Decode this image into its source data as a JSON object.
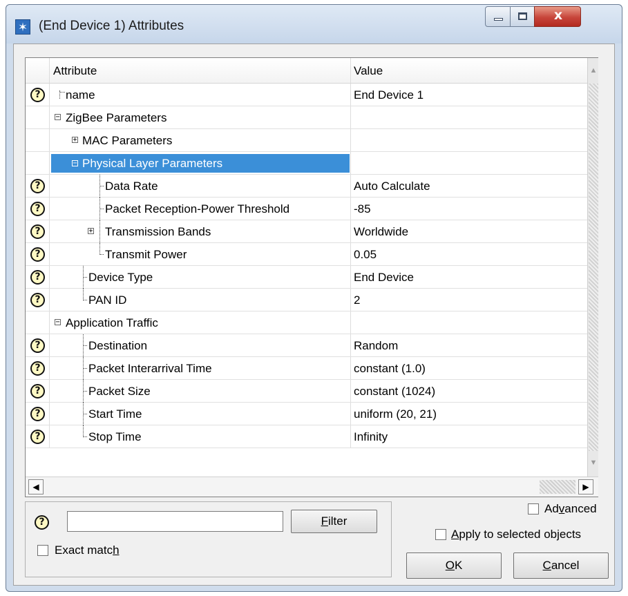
{
  "window": {
    "title": "(End Device 1) Attributes",
    "app_icon": "✶",
    "close_glyph": "x"
  },
  "table": {
    "header": {
      "attribute": "Attribute",
      "value": "Value"
    },
    "rows": [
      {
        "label": "name",
        "value": "End Device 1",
        "help": true
      },
      {
        "label": "ZigBee Parameters",
        "value": "",
        "help": false
      },
      {
        "label": "MAC Parameters",
        "value": "",
        "help": false
      },
      {
        "label": "Physical Layer Parameters",
        "value": "",
        "help": false
      },
      {
        "label": "Data Rate",
        "value": "Auto Calculate",
        "help": true
      },
      {
        "label": "Packet Reception-Power Threshold",
        "value": "-85",
        "help": true
      },
      {
        "label": "Transmission Bands",
        "value": "Worldwide",
        "help": true
      },
      {
        "label": "Transmit Power",
        "value": "0.05",
        "help": true
      },
      {
        "label": "Device Type",
        "value": "End Device",
        "help": true
      },
      {
        "label": "PAN ID",
        "value": "2",
        "help": true
      },
      {
        "label": "Application Traffic",
        "value": "",
        "help": false
      },
      {
        "label": "Destination",
        "value": "Random",
        "help": true
      },
      {
        "label": "Packet Interarrival Time",
        "value": "constant (1.0)",
        "help": true
      },
      {
        "label": "Packet Size",
        "value": "constant (1024)",
        "help": true
      },
      {
        "label": "Start Time",
        "value": "uniform (20, 21)",
        "help": true
      },
      {
        "label": "Stop Time",
        "value": "Infinity",
        "help": true
      }
    ]
  },
  "icons": {
    "help": "?",
    "expanded": "−",
    "collapsed": "+"
  },
  "filter": {
    "input_value": "",
    "button_prefix": "",
    "button_mnemonic": "F",
    "button_rest": "ilter",
    "exact_prefix": "Exact matc",
    "exact_mnemonic": "h",
    "exact_rest": ""
  },
  "options": {
    "advanced_prefix": "Ad",
    "advanced_mnemonic": "v",
    "advanced_rest": "anced",
    "apply_prefix": "",
    "apply_mnemonic": "A",
    "apply_rest": "pply to selected objects"
  },
  "buttons": {
    "ok_mnemonic": "O",
    "ok_rest": "K",
    "cancel_mnemonic": "C",
    "cancel_rest": "ancel"
  }
}
